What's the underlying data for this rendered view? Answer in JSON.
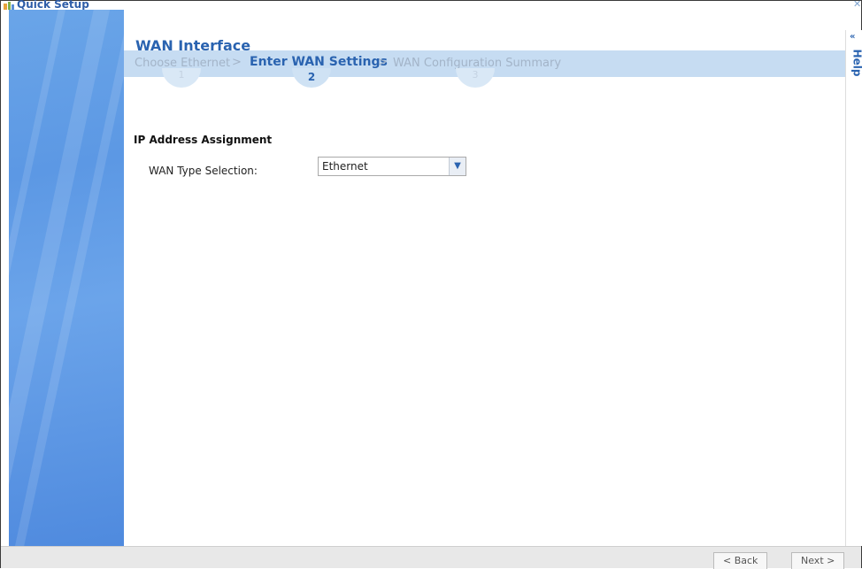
{
  "window": {
    "title": "Quick Setup",
    "close_label": "✕"
  },
  "page": {
    "title": "WAN Interface"
  },
  "steps": [
    {
      "label": "Choose Ethernet",
      "number": "1",
      "active": false
    },
    {
      "label": "Enter WAN Settings",
      "number": "2",
      "active": true
    },
    {
      "label": "WAN Configuration Summary",
      "number": "3",
      "active": false
    }
  ],
  "step_separator": ">",
  "form": {
    "section_title": "IP Address Assignment",
    "wan_type_label": "WAN Type Selection:",
    "wan_type_value": "Ethernet"
  },
  "help": {
    "label": "Help",
    "collapse_label": "«"
  },
  "footer": {
    "back_label": "< Back",
    "next_label": "Next >"
  },
  "colors": {
    "accent": "#2a63b0",
    "panel": "#5c98e4",
    "stepbar": "#c6dcf2"
  },
  "icons": {
    "app": "quick-setup-icon",
    "dropdown": "chevron-down-icon"
  }
}
